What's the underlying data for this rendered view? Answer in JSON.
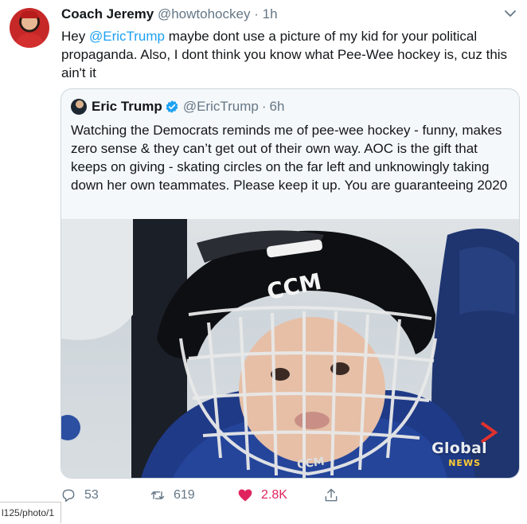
{
  "tweet": {
    "author_name": "Coach Jeremy",
    "author_handle": "@howtohockey",
    "separator": "·",
    "time": "1h",
    "text_prefix": "Hey ",
    "mention": "@EricTrump",
    "text_suffix": " maybe dont use a picture of my kid for your political propaganda. Also, I dont think you know what Pee-Wee hockey is, cuz this ain't it"
  },
  "quoted": {
    "author_name": "Eric Trump",
    "author_handle": "@EricTrump",
    "separator": "·",
    "time": "6h",
    "text": "Watching the Democrats reminds me of pee-wee hockey - funny, makes zero sense & they can’t get out of their own way. AOC is the gift that keeps on giving - skating circles on the far left and unknowingly taking down her own teammates. Please keep it up. You are guaranteeing 2020",
    "photo": {
      "helmet_brand": "CCM",
      "cage_brand": "CCM",
      "watermark_main": "Global",
      "watermark_sub": "NEWS"
    }
  },
  "actions": {
    "reply_count": "53",
    "retweet_count": "619",
    "like_count": "2.8K"
  },
  "status_bar": {
    "url": "l125/photo/1"
  },
  "colors": {
    "accent": "#1da1f2",
    "like": "#e0245e",
    "muted": "#657786"
  },
  "icons": {
    "reply": "reply-icon",
    "retweet": "retweet-icon",
    "like": "heart-icon",
    "share": "share-icon",
    "menu": "chevron-down-icon",
    "verified": "verified-badge-icon"
  }
}
